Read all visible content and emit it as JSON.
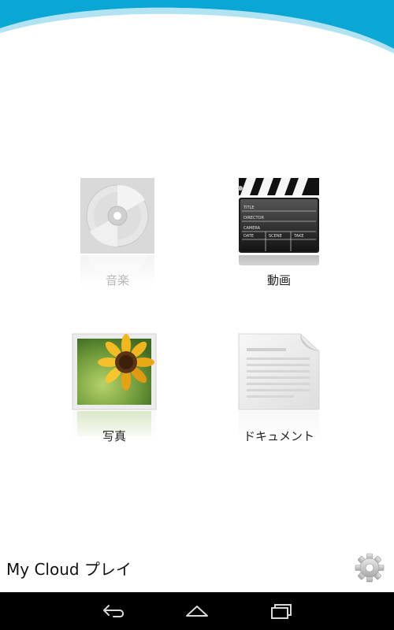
{
  "app": {
    "title": "My Cloud プレイ",
    "accent_color": "#0aa6d4"
  },
  "tiles": [
    {
      "label": "音楽",
      "icon": "cd-disc-icon",
      "enabled": false
    },
    {
      "label": "動画",
      "icon": "clapperboard-icon",
      "enabled": true
    },
    {
      "label": "写真",
      "icon": "sunflower-photo-icon",
      "enabled": true
    },
    {
      "label": "ドキュメント",
      "icon": "document-icon",
      "enabled": true
    }
  ],
  "clapperboard": {
    "rows": [
      "TITLE",
      "DIRECTOR",
      "CAMERA"
    ],
    "columns": [
      "DATE",
      "SCENE",
      "TAKE"
    ]
  },
  "settings": {
    "icon": "gear-icon"
  },
  "nav": {
    "back_icon": "back-icon",
    "home_icon": "home-icon",
    "recents_icon": "recents-icon"
  }
}
